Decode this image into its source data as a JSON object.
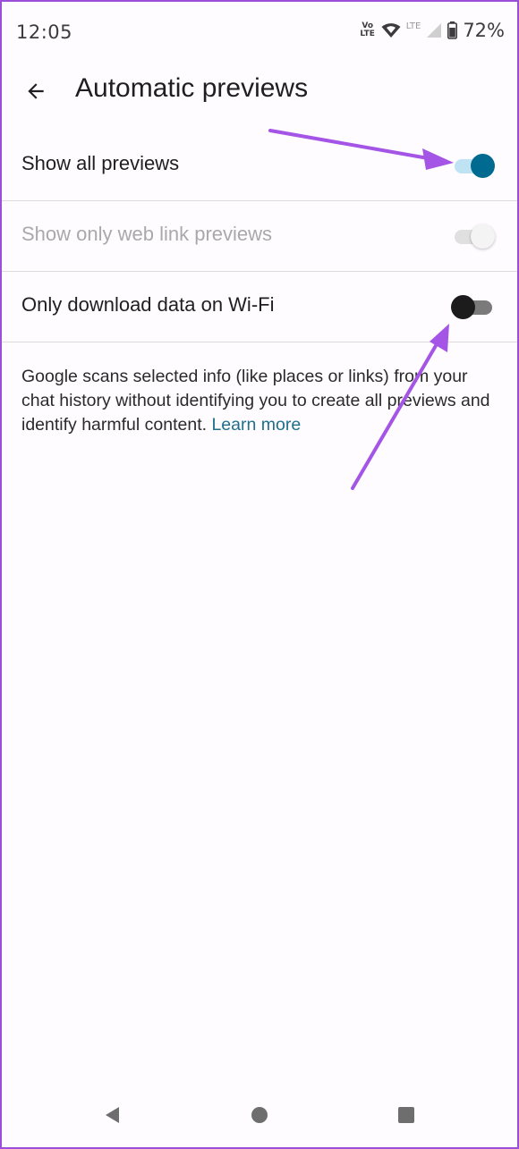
{
  "status_bar": {
    "time": "12:05",
    "volte_line1": "Vo",
    "volte_line2": "LTE",
    "lte": "LTE",
    "battery_percent": "72%"
  },
  "app_bar": {
    "title": "Automatic previews",
    "back_icon": "arrow-back-icon"
  },
  "settings": [
    {
      "label": "Show all previews",
      "state": "on",
      "enabled": true
    },
    {
      "label": "Show only web link previews",
      "state": "on",
      "enabled": false
    },
    {
      "label": "Only download data on Wi-Fi",
      "state": "off",
      "enabled": true
    }
  ],
  "description": {
    "text": "Google scans selected info (like places or links) from your chat history without identifying you to create all previews and identify harmful content. ",
    "link_label": "Learn more"
  },
  "nav_bar": {
    "back_icon": "triangle-back-icon",
    "home_icon": "circle-home-icon",
    "recents_icon": "square-recents-icon"
  },
  "colors": {
    "accent": "#006a90",
    "switch_on_track": "#bfe3f3",
    "annotation_arrow": "#a455e6",
    "link": "#1f6f8b",
    "frame_border": "#9b4fd9"
  }
}
